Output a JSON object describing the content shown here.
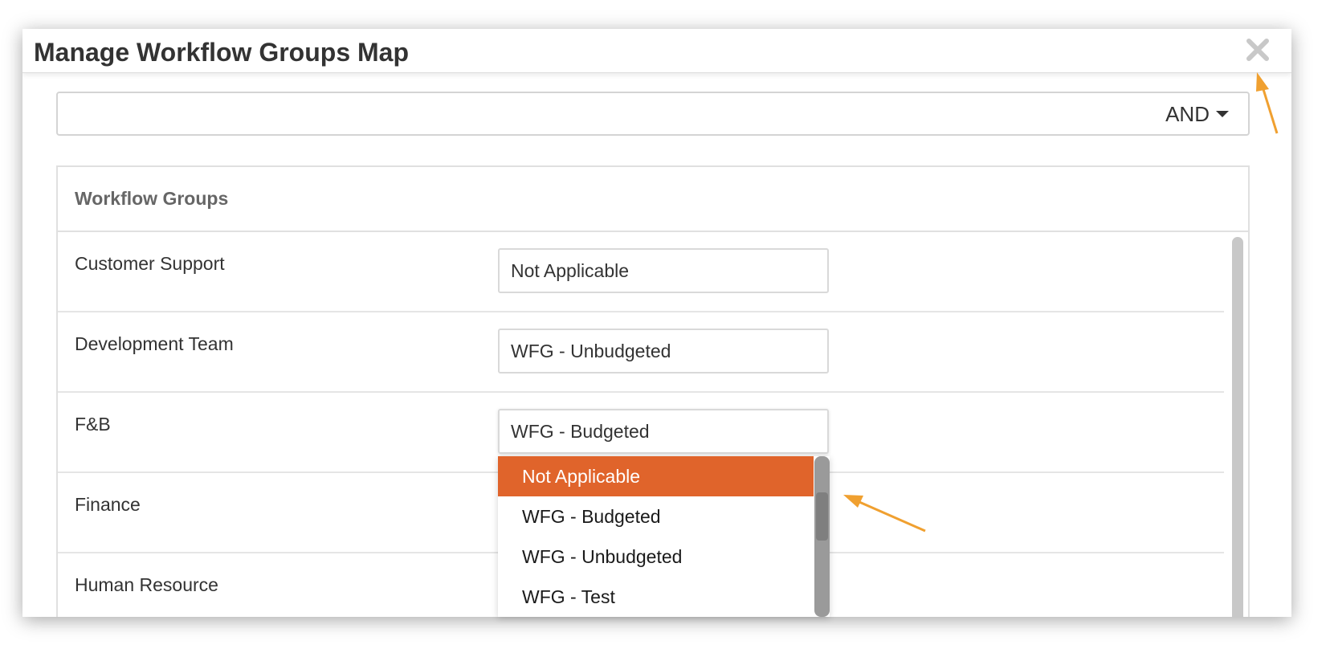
{
  "dialog": {
    "title": "Manage Workflow Groups Map",
    "close_icon": "close-icon"
  },
  "operator": {
    "value": "AND",
    "icon": "caret-down-icon"
  },
  "panel": {
    "heading": "Workflow Groups",
    "rows": [
      {
        "label": "Customer Support",
        "value": "Not Applicable"
      },
      {
        "label": "Development Team",
        "value": "WFG - Unbudgeted"
      },
      {
        "label": "F&B",
        "value": "WFG - Budgeted"
      },
      {
        "label": "Finance",
        "value": ""
      },
      {
        "label": "Human Resource",
        "value": ""
      }
    ]
  },
  "dropdown": {
    "options": [
      {
        "label": "Not Applicable",
        "selected": true
      },
      {
        "label": "WFG - Budgeted",
        "selected": false
      },
      {
        "label": "WFG - Unbudgeted",
        "selected": false
      },
      {
        "label": "WFG - Test",
        "selected": false
      }
    ]
  },
  "colors": {
    "accent": "#e0642b",
    "annotation_arrow": "#f0a030",
    "close_icon": "#c8c8c8"
  }
}
